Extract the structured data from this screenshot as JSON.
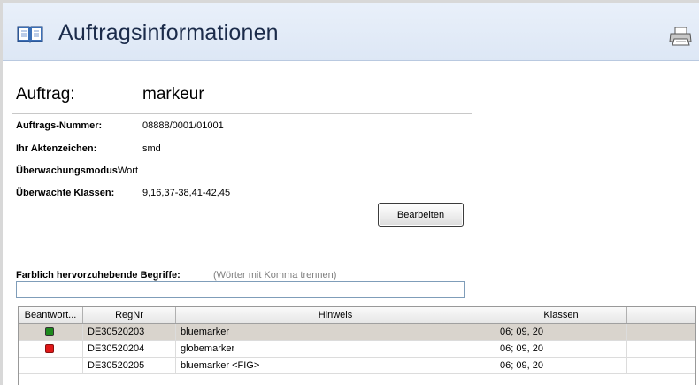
{
  "header": {
    "title": "Auftragsinformationen",
    "icons": {
      "left": "book-icon",
      "right": "printer-icon"
    }
  },
  "auftrag": {
    "label": "Auftrag:",
    "value": "markeur"
  },
  "fields": [
    {
      "label": "Auftrags-Nummer:",
      "value": "08888/0001/01001"
    },
    {
      "label": "Ihr Aktenzeichen:",
      "value": "smd"
    },
    {
      "label": "Überwachungsmodus:",
      "value": "Wort"
    },
    {
      "label": "Überwachte Klassen:",
      "value": "9,16,37-38,41-42,45"
    }
  ],
  "edit_button": "Bearbeiten",
  "highlight": {
    "label": "Farblich hervorzuhebende Begriffe:",
    "hint": "(Wörter mit Komma trennen)",
    "value": ""
  },
  "table": {
    "columns": [
      "Beantwort...",
      "RegNr",
      "Hinweis",
      "Klassen",
      ""
    ],
    "rows": [
      {
        "status": "green",
        "regnr": "DE30520203",
        "hinweis": "bluemarker",
        "klassen": "06; 09, 20"
      },
      {
        "status": "red",
        "regnr": "DE30520204",
        "hinweis": "globemarker",
        "klassen": "06; 09, 20"
      },
      {
        "status": "",
        "regnr": "DE30520205",
        "hinweis": "bluemarker <FIG>",
        "klassen": "06; 09, 20"
      }
    ]
  },
  "colors": {
    "header_bg": "#e4ecf8",
    "selected_row": "#d9d4cd",
    "status_green": "#1e8a1e",
    "status_red": "#e01818"
  }
}
